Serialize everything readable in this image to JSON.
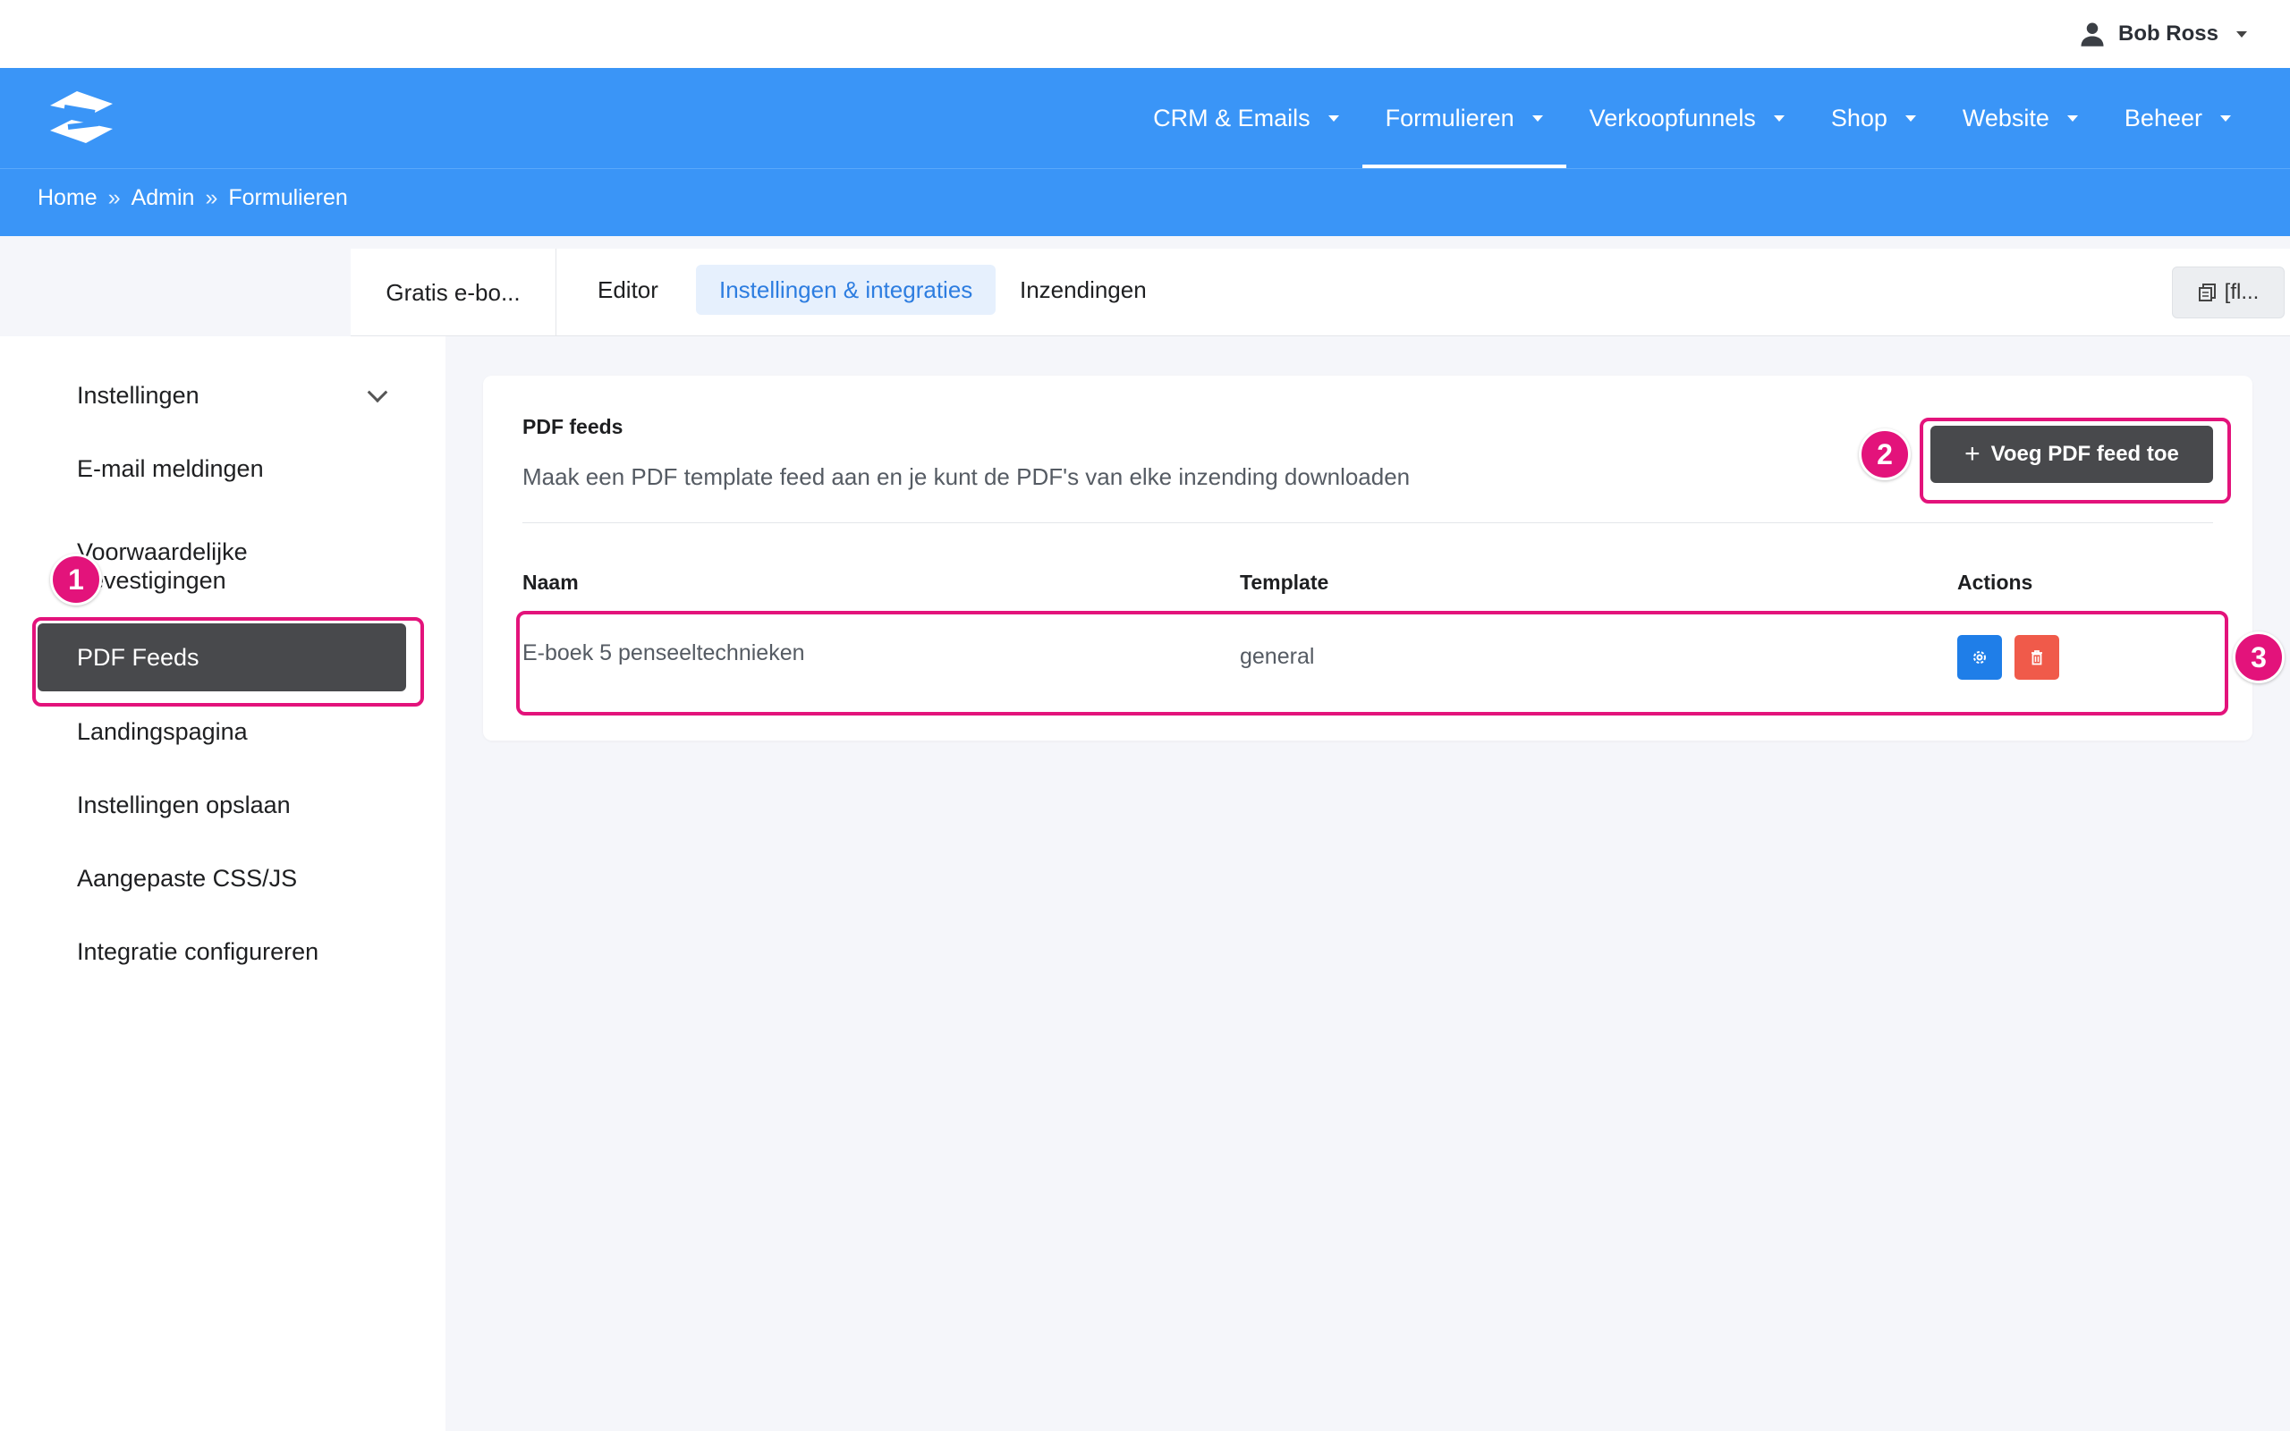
{
  "user": {
    "name": "Bob Ross",
    "icon": "user-icon"
  },
  "brand": {
    "logo_icon": "brand-logo-icon",
    "primary_color": "#3a95f7",
    "annotation_color": "#e3137b"
  },
  "nav": {
    "items": [
      {
        "label": "CRM & Emails",
        "active": false
      },
      {
        "label": "Formulieren",
        "active": true
      },
      {
        "label": "Verkoopfunnels",
        "active": false
      },
      {
        "label": "Shop",
        "active": false
      },
      {
        "label": "Website",
        "active": false
      },
      {
        "label": "Beheer",
        "active": false
      }
    ]
  },
  "breadcrumb": {
    "items": [
      "Home",
      "Admin",
      "Formulieren"
    ],
    "separator": "»"
  },
  "tabs": {
    "form_name": "Gratis e-bo...",
    "items": [
      {
        "label": "Editor",
        "active": false
      },
      {
        "label": "Instellingen & integraties",
        "active": true
      },
      {
        "label": "Inzendingen",
        "active": false
      }
    ],
    "shortcode_label": "[fl..."
  },
  "sidebar": {
    "items": [
      {
        "label": "Instellingen",
        "has_chevron": true
      },
      {
        "label": "E-mail meldingen"
      },
      {
        "label": "Voorwaardelijke\nbevestigingen"
      },
      {
        "label": "PDF Feeds",
        "active": true
      },
      {
        "label": "Landingspagina"
      },
      {
        "label": "Instellingen opslaan"
      },
      {
        "label": "Aangepaste CSS/JS"
      },
      {
        "label": "Integratie configureren"
      }
    ]
  },
  "panel": {
    "title": "PDF feeds",
    "description": "Maak een PDF template feed aan en je kunt de PDF's van elke inzending downloaden",
    "add_button": "Voeg PDF feed toe",
    "table": {
      "columns": [
        "Naam",
        "Template",
        "Actions"
      ],
      "rows": [
        {
          "name": "E-boek 5 penseeltechnieken",
          "template": "general"
        }
      ]
    }
  },
  "annotations": {
    "badges": [
      "1",
      "2",
      "3"
    ]
  }
}
